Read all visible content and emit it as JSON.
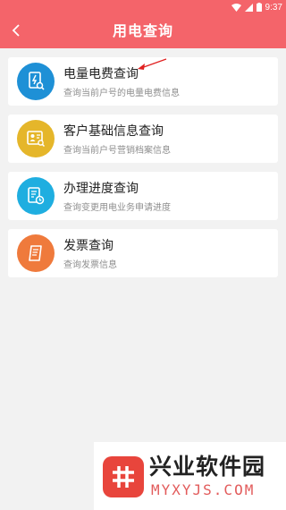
{
  "status_bar": {
    "time": "9:37"
  },
  "header": {
    "title": "用电查询"
  },
  "items": [
    {
      "title": "电量电费查询",
      "subtitle": "查询当前户号的电量电费信息",
      "icon": "bill-document-icon",
      "color": "#1e90d6"
    },
    {
      "title": "客户基础信息查询",
      "subtitle": "查询当前户号营销档案信息",
      "icon": "profile-card-icon",
      "color": "#e5b62a"
    },
    {
      "title": "办理进度查询",
      "subtitle": "查询变更用电业务申请进度",
      "icon": "progress-clock-icon",
      "color": "#1faee0"
    },
    {
      "title": "发票查询",
      "subtitle": "查询发票信息",
      "icon": "invoice-scroll-icon",
      "color": "#ef7a3c"
    }
  ],
  "watermark": {
    "name": "兴业软件园",
    "url": "MYXYJS.COM"
  }
}
